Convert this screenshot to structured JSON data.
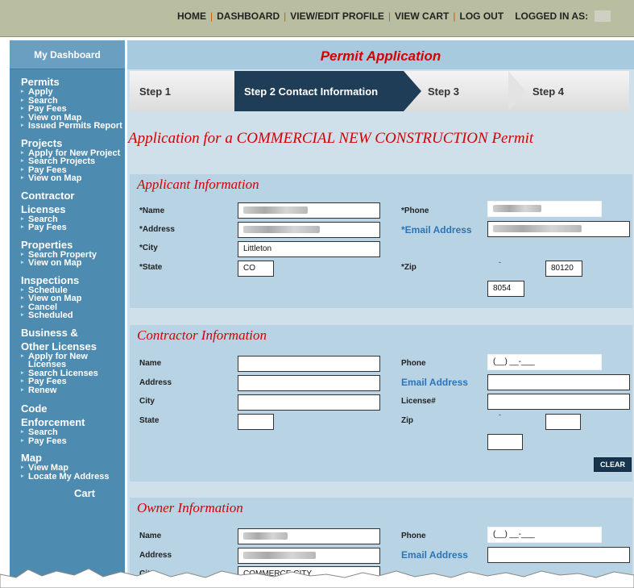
{
  "topnav": {
    "home": "HOME",
    "dashboard": "DASHBOARD",
    "profile": "VIEW/EDIT PROFILE",
    "cart": "VIEW CART",
    "logout": "LOG OUT",
    "logged_in": "LOGGED IN AS:",
    "separator": "|"
  },
  "sidebar": {
    "dashboard": "My Dashboard",
    "sections": [
      {
        "title": "Permits",
        "items": [
          "Apply",
          "Search",
          "Pay Fees",
          "View on Map",
          "Issued Permits Report"
        ]
      },
      {
        "title": "Projects",
        "items": [
          "Apply for New Project",
          "Search Projects",
          "Pay Fees",
          "View on Map"
        ]
      },
      {
        "title_line1": "Contractor",
        "title_line2": "Licenses",
        "items": [
          "Search",
          "Pay Fees"
        ]
      },
      {
        "title": "Properties",
        "items": [
          "Search Property",
          "View on Map"
        ]
      },
      {
        "title": "Inspections",
        "items": [
          "Schedule",
          "View on Map",
          "Cancel",
          "Scheduled"
        ]
      },
      {
        "title_line1": "Business &",
        "title_line2": "Other Licenses",
        "items": [
          "Apply for New",
          "Licenses",
          "Search Licenses",
          "Pay Fees",
          "Renew"
        ]
      },
      {
        "title_line1": "Code",
        "title_line2": "Enforcement",
        "items": [
          "Search",
          "Pay Fees"
        ]
      },
      {
        "title": "Map",
        "items": [
          "View Map",
          "Locate My Address"
        ]
      },
      {
        "title": "Cart"
      }
    ]
  },
  "page": {
    "title": "Permit Application",
    "steps": [
      "Step 1",
      "Step 2  Contact Information",
      "Step 3",
      "Step 4"
    ],
    "application_title": "Application for a COMMERCIAL NEW CONSTRUCTION Permit"
  },
  "applicant": {
    "heading": "Applicant Information",
    "labels": {
      "name": "*Name",
      "address": "*Address",
      "city": "*City",
      "state": "*State",
      "phone": "*Phone",
      "email": "*Email Address",
      "zip": "*Zip"
    },
    "values": {
      "city": "Littleton",
      "state": "CO",
      "zip": "80120",
      "zip_ext": "8054"
    }
  },
  "contractor": {
    "heading": "Contractor Information",
    "labels": {
      "name": "Name",
      "address": "Address",
      "city": "City",
      "state": "State",
      "phone": "Phone",
      "email": "Email Address",
      "license": "License#",
      "zip": "Zip"
    },
    "phone_placeholder": "(__) __-___",
    "clear": "CLEAR"
  },
  "owner": {
    "heading": "Owner Information",
    "labels": {
      "name": "Name",
      "address": "Address",
      "city": "City",
      "phone": "Phone",
      "email": "Email Address"
    },
    "values": {
      "city": "COMMERCE CITY"
    },
    "phone_placeholder": "(__) __-___"
  },
  "zip_dash": "-",
  "colors": {
    "accent_red": "#d40000",
    "sidebar_blue": "#4e8bb1",
    "active_step": "#1f3d57",
    "link_blue": "#2b75b8"
  }
}
